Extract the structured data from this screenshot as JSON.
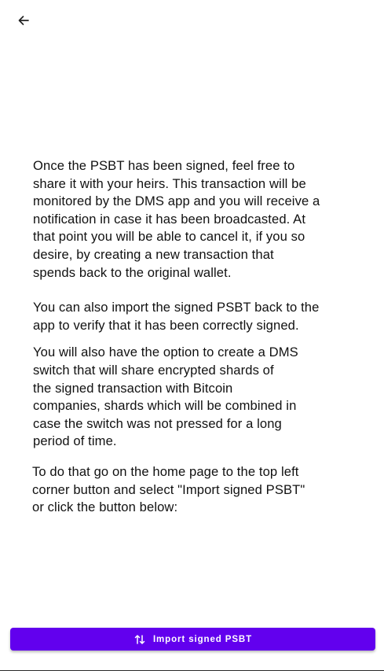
{
  "header": {
    "back_icon": "arrow-left-icon"
  },
  "content": {
    "paragraph1": "Once the PSBT has been signed, feel free to\nshare it with your heirs. This transaction will be\nmonitored by the DMS app and you will receive a\nnotification in case it has been broadcasted. At\nthat point you will be able to cancel it, if you so\ndesire, by creating a new transaction that\nspends back to the original wallet.",
    "paragraph2": "You can also import the signed PSBT back to the\napp to verify that it has been correctly signed.",
    "paragraph3": "You will also have the option to create a DMS\nswitch that will share encrypted shards of\nthe signed transaction with Bitcoin\ncompanies, shards which will be combined in\ncase the switch was not pressed for a long\nperiod of time.",
    "paragraph4": "To do that go on the home page to the top left\ncorner button and select \"Import signed PSBT\"\nor click the button below:"
  },
  "import_button": {
    "label": "Import signed PSBT",
    "icon": "swap-vertical-icon",
    "color": "#6200ee"
  }
}
